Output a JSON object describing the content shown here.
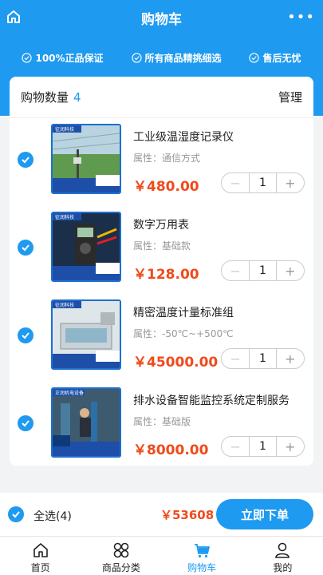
{
  "header": {
    "title": "购物车",
    "more": "•••",
    "home_icon": "home-icon"
  },
  "guarantees": [
    {
      "label": "100%正品保证"
    },
    {
      "label": "所有商品精挑细选"
    },
    {
      "label": "售后无忧"
    }
  ],
  "cart": {
    "label": "购物数量",
    "count": "4",
    "manage_label": "管理",
    "items": [
      {
        "name": "工业级温湿度记录仪",
        "attr": "属性：通信方式",
        "price": "￥480.00",
        "qty": "1",
        "checked": true,
        "thumb_banner": "征润科技"
      },
      {
        "name": "数字万用表",
        "attr": "属性：基础款",
        "price": "￥128.00",
        "qty": "1",
        "checked": true,
        "thumb_banner": "征润科技"
      },
      {
        "name": "精密温度计量标准组",
        "attr": "属性：-50℃~+500℃",
        "price": "￥45000.00",
        "qty": "1",
        "checked": true,
        "thumb_banner": "征润科技"
      },
      {
        "name": "排水设备智能监控系统定制服务",
        "attr": "属性：基础版",
        "price": "￥8000.00",
        "qty": "1",
        "checked": true,
        "thumb_banner": "正润机电设备"
      }
    ],
    "stepper": {
      "minus": "−",
      "plus": "+"
    }
  },
  "checkout": {
    "select_all_label": "全选(4)",
    "total": "￥53608",
    "order_button": "立即下单"
  },
  "tabbar": [
    {
      "label": "首页",
      "icon": "home-icon",
      "active": false
    },
    {
      "label": "商品分类",
      "icon": "grid-icon",
      "active": false
    },
    {
      "label": "购物车",
      "icon": "cart-icon",
      "active": true
    },
    {
      "label": "我的",
      "icon": "user-icon",
      "active": false
    }
  ],
  "colors": {
    "primary": "#1e9af0",
    "price": "#f04a1c"
  }
}
